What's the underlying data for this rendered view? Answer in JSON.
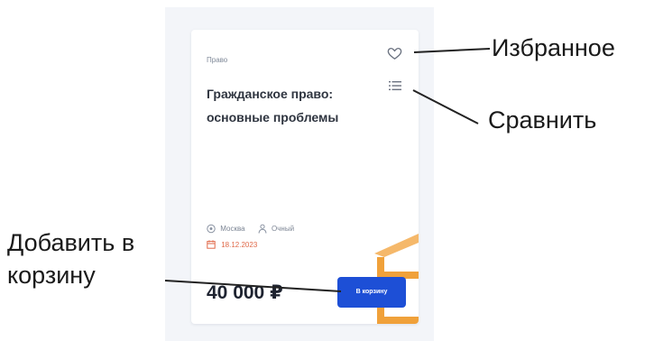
{
  "card": {
    "category": "Право",
    "title": "Гражданское право: основные проблемы",
    "city": "Москва",
    "format": "Очный",
    "date": "18.12.2023",
    "price": "40 000 ₽",
    "cart_button_label": "В корзину"
  },
  "annotations": {
    "favorite": "Избранное",
    "compare": "Сравнить",
    "add_to_cart_line1": "Добавить в",
    "add_to_cart_line2": "корзину"
  },
  "icons": {
    "favorite": "heart-icon",
    "compare": "list-icon",
    "location": "location-pin-icon",
    "format": "person-icon",
    "date": "calendar-icon"
  },
  "colors": {
    "accent_button": "#1d4fd6",
    "date_text": "#e06a4a",
    "decoration": "#f0a13a"
  }
}
